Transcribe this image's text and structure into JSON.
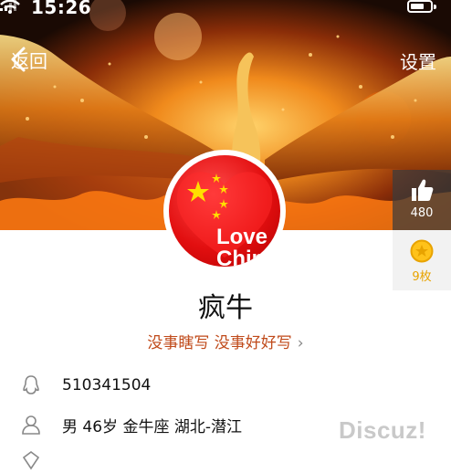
{
  "status_bar": {
    "time": "15:26"
  },
  "nav": {
    "back_label": "返回",
    "settings_label": "设置"
  },
  "stats": {
    "likes": "480",
    "medals": "9枚"
  },
  "avatar": {
    "text_line1": "Love",
    "text_line2": "Chin"
  },
  "profile": {
    "name": "疯牛",
    "signature": "没事瞎写 没事好好写",
    "qq": "510341504",
    "details": "男 46岁 金牛座 湖北-潜江"
  },
  "watermark": "Discuz!",
  "colors": {
    "signature": "#c04a1a",
    "medal": "#e8a300",
    "flag_red": "#e20f10"
  }
}
